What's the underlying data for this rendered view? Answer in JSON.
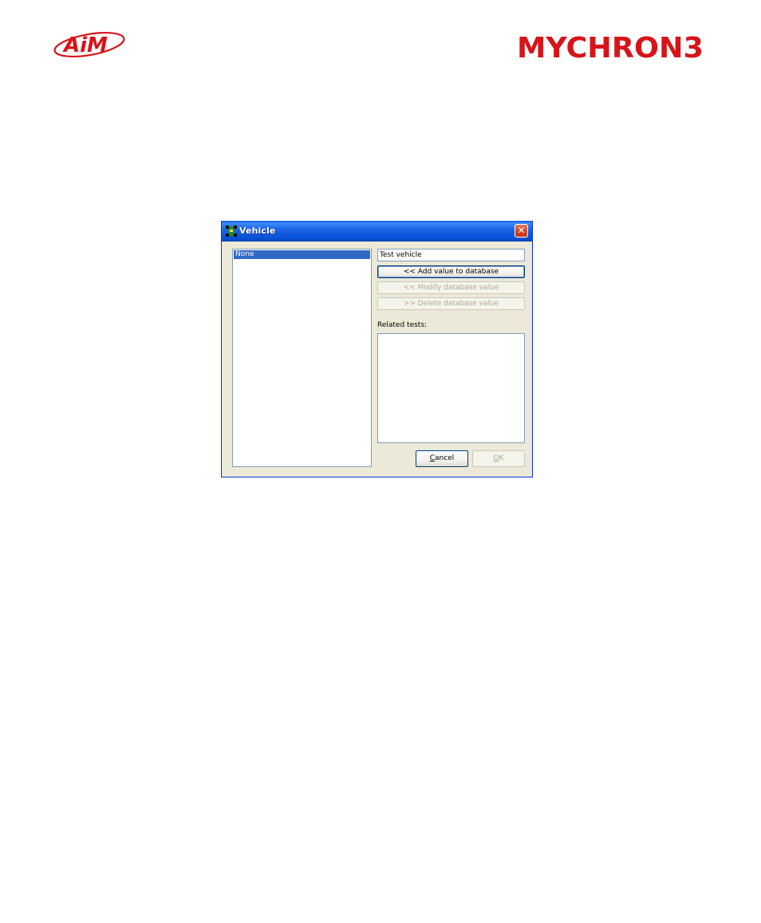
{
  "header": {
    "brand_left": "AiM",
    "brand_right": "MYCHRON3"
  },
  "dialog": {
    "title": "Vehicle",
    "close_glyph": "✕",
    "list_items": [
      "None"
    ],
    "vehicle_name_value": "Test vehicle",
    "add_button": "<< Add value to database",
    "modify_button": "<< Modify database value",
    "delete_button": ">> Delete database value",
    "related_label": "Related tests:",
    "cancel_button": {
      "prefix": "",
      "accel": "C",
      "rest": "ancel"
    },
    "ok_button": {
      "prefix": "",
      "accel": "O",
      "rest": "K"
    }
  },
  "colors": {
    "titlebar": "#0852d6",
    "selection": "#316ac5",
    "dialog_bg": "#ece9d8",
    "brand_red": "#d7141a"
  }
}
